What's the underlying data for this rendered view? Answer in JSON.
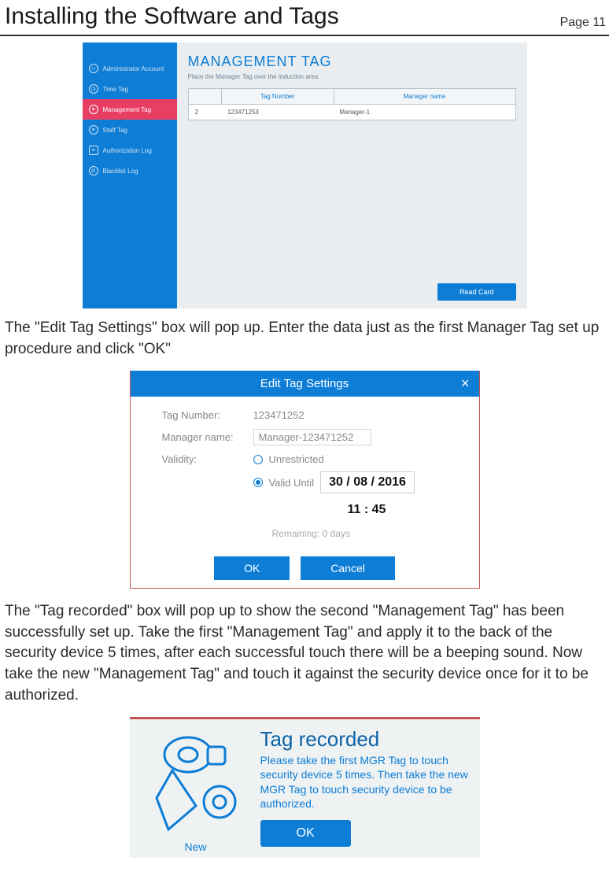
{
  "header": {
    "title": "Installing the Software and Tags",
    "page_label": "Page 11"
  },
  "paragraph1": "The \"Edit Tag Settings\" box will pop up. Enter the data just as the first Manager Tag set up procedure and click \"OK\"",
  "paragraph2": "The \"Tag recorded\" box will pop up to show the second \"Management Tag\" has been successfully set up. Take the first \"Management Tag\" and apply it to the back of the security device 5 times, after each successful touch there will be a beeping sound. Now take the new \"Management Tag\" and touch it against the security device once for it to be authorized.",
  "management_screen": {
    "sidebar": [
      "Administrator Account",
      "Time Tag",
      "Management Tag",
      "Staff Tag",
      "Authorization Log",
      "Blacklist Log"
    ],
    "title": "MANAGEMENT TAG",
    "subtitle": "Place the Manager Tag over the induction area.",
    "columns": {
      "idx": "",
      "tag": "Tag Number",
      "mgr": "Manager name"
    },
    "row": {
      "idx": "2",
      "tag": "123471253",
      "mgr": "Manager-1"
    },
    "read_card_btn": "Read Card"
  },
  "edit_dialog": {
    "title": "Edit Tag Settings",
    "close": "×",
    "labels": {
      "tag_number": "Tag Number:",
      "manager_name": "Manager name:",
      "validity": "Validity:",
      "unrestricted": "Unrestricted",
      "valid_until": "Valid Until"
    },
    "values": {
      "tag_number": "123471252",
      "manager_name": "Manager-123471252",
      "date": "30 / 08 / 2016",
      "time": "11 : 45",
      "remaining": "Remaining: 0 days"
    },
    "buttons": {
      "ok": "OK",
      "cancel": "Cancel"
    }
  },
  "tag_recorded": {
    "new_label": "New",
    "title": "Tag recorded",
    "message": "Please take the first MGR Tag to touch security device 5 times. Then take the new MGR Tag to touch security device to be authorized.",
    "ok": "OK"
  }
}
